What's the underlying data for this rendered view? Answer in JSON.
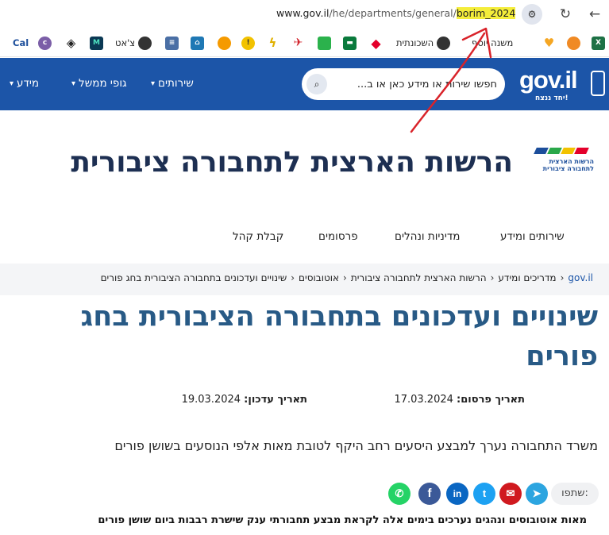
{
  "browser": {
    "url_main": "www.gov.il",
    "url_path": "/he/departments/general/",
    "url_highlight": "borim_2024",
    "back_icon": "arrow-left-icon",
    "reload_icon": "reload-icon",
    "site_info_icon": "tune-icon"
  },
  "bookmarks": [
    {
      "label": "",
      "icon": "excel-icon",
      "color": "#1e7145",
      "glyph": "X"
    },
    {
      "label": "",
      "icon": "fox-icon",
      "color": "#f08a24",
      "glyph": "●"
    },
    {
      "label": "",
      "icon": "heart-icon",
      "color": "#f5a623",
      "glyph": "♥"
    },
    {
      "label": "משנה יוסף",
      "icon": "book-icon",
      "color": "#ffffff",
      "glyph": ""
    },
    {
      "label": "השכונתית",
      "icon": "globe-icon",
      "color": "#333333",
      "glyph": "◍"
    },
    {
      "label": "",
      "icon": "red-diamond-icon",
      "color": "#e4002b",
      "glyph": "◆"
    },
    {
      "label": "",
      "icon": "green-flag-icon",
      "color": "#0a7a3c",
      "glyph": "▬"
    },
    {
      "label": "",
      "icon": "chat-icon",
      "color": "#2bb24c",
      "glyph": "■"
    },
    {
      "label": "",
      "icon": "airline-icon",
      "color": "#d12028",
      "glyph": "✈"
    },
    {
      "label": "",
      "icon": "lightning-icon",
      "color": "#f2c200",
      "glyph": "ϟ"
    },
    {
      "label": "",
      "icon": "info-circle-icon",
      "color": "#f2c200",
      "glyph": "!"
    },
    {
      "label": "",
      "icon": "orange-badge-icon",
      "color": "#f59a00",
      "glyph": "◒"
    },
    {
      "label": "",
      "icon": "house-icon",
      "color": "#1f78b4",
      "glyph": "⌂"
    },
    {
      "label": "",
      "icon": "stripes-icon",
      "color": "#4a6fa5",
      "glyph": "≡"
    },
    {
      "label": "צ'אט",
      "icon": "globe-icon",
      "color": "#333333",
      "glyph": "◍"
    },
    {
      "label": "",
      "icon": "m-icon",
      "color": "#0b3954",
      "glyph": "M"
    },
    {
      "label": "",
      "icon": "layers-icon",
      "color": "#222222",
      "glyph": "◈"
    },
    {
      "label": "",
      "icon": "city-icon",
      "color": "#7b5ea7",
      "glyph": "c"
    },
    {
      "label": "Cal",
      "icon": "",
      "color": "",
      "glyph": ""
    }
  ],
  "gov": {
    "logo_text": "gov.il",
    "logo_tagline": "יחד ננצח!",
    "search_placeholder": "חפשו שירות או מידע כאן או ב...",
    "nav": [
      "שירותים",
      "גופי ממשל",
      "מידע"
    ]
  },
  "ministry": {
    "title": "הרשות הארצית לתחבורה ציבורית",
    "logo_text": "הרשות הארצית לתחבורה ציבורית",
    "logo_colors": [
      "#1c4e9b",
      "#2aa84a",
      "#f2c200",
      "#e4002b"
    ],
    "nav": [
      "שירותים ומידע",
      "מדיניות ונהלים",
      "פרסומים",
      "קבלת קהל"
    ]
  },
  "breadcrumb": [
    "gov.il",
    "מדריכים ומידע",
    "הרשות הארצית לתחבורה ציבורית",
    "אוטובוסים",
    "שינויים ועדכונים בתחבורה הציבורית בחג פורים"
  ],
  "article": {
    "title": "שינויים ועדכונים בתחבורה הציבורית בחג פורים",
    "published_label": "תאריך פרסום:",
    "published": "17.03.2024",
    "updated_label": "תאריך עדכון:",
    "updated": "19.03.2024",
    "lead": "משרד התחבורה נערך למבצע היסעים רחב היקף לטובת מאות אלפי הנוסעים בשושן פורים",
    "share_label": "שתפו:",
    "body_start": "מאות אוטובוסים ונהגים נערכים בימים אלה לקראת מבצע תחבורתי ענק שישרת רבבות ביום שושן פורים"
  },
  "share": [
    {
      "icon": "telegram-icon",
      "color": "#2ca5e0",
      "glyph": "➤"
    },
    {
      "icon": "email-icon",
      "color": "#d0191f",
      "glyph": "✉"
    },
    {
      "icon": "twitter-icon",
      "color": "#1da1f2",
      "glyph": "t"
    },
    {
      "icon": "linkedin-icon",
      "color": "#0a66c2",
      "glyph": "in"
    },
    {
      "icon": "facebook-icon",
      "color": "#3b5998",
      "glyph": "f"
    },
    {
      "icon": "whatsapp-icon",
      "color": "#25d366",
      "glyph": "✆"
    }
  ],
  "colors": {
    "gov_blue": "#1c55a8",
    "title_navy": "#1d2f52",
    "headline_blue": "#285a86",
    "annotation_red": "#d9232a",
    "url_highlight": "#f4ed3a"
  }
}
